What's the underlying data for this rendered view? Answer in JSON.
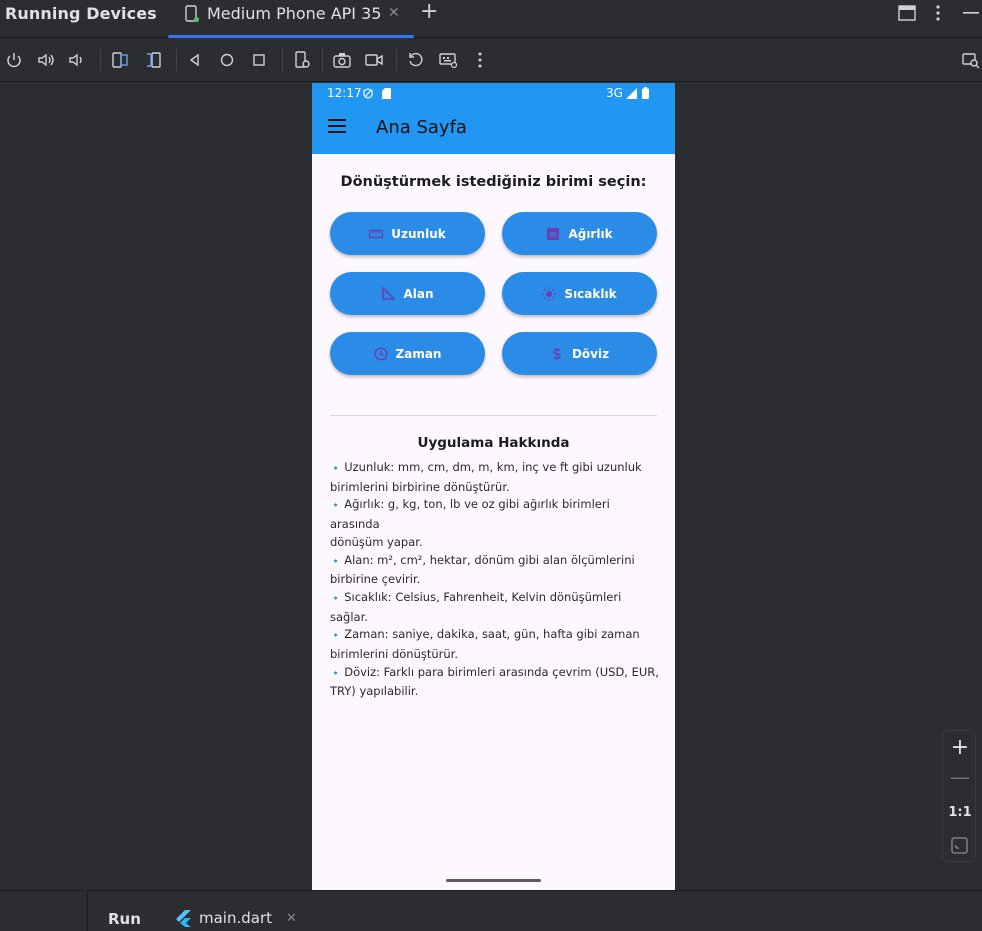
{
  "ide": {
    "panel_title": "Running Devices",
    "device_tab": "Medium Phone API 35",
    "bottom": {
      "run_label": "Run",
      "file_tab": "main.dart"
    },
    "zoom": {
      "one_to_one": "1:1"
    },
    "toolbar_icons": [
      "power-icon",
      "volume-up-icon",
      "volume-down-icon",
      "rotate-left-icon",
      "rotate-right-icon",
      "back-icon",
      "home-icon",
      "overview-icon",
      "device-settings-icon",
      "screenshot-icon",
      "screen-record-icon",
      "reset-icon",
      "keyboard-icon",
      "more-icon"
    ]
  },
  "phone": {
    "status": {
      "time": "12:17",
      "network": "3G"
    },
    "appbar": {
      "title": "Ana Sayfa"
    },
    "heading": "Dönüştürmek istediğiniz birimi seçin:",
    "buttons": [
      {
        "label": "Uzunluk",
        "icon": "ruler-icon"
      },
      {
        "label": "Ağırlık",
        "icon": "weight-icon"
      },
      {
        "label": "Alan",
        "icon": "area-icon"
      },
      {
        "label": "Sıcaklık",
        "icon": "sun-icon"
      },
      {
        "label": "Zaman",
        "icon": "clock-icon"
      },
      {
        "label": "Döviz",
        "icon": "dollar-icon"
      }
    ],
    "about": {
      "title": "Uygulama Hakkında",
      "lines": [
        "Uzunluk: mm, cm, dm, m, km, inç ve ft gibi uzunluk",
        "birimlerini birbirine dönüştürür.",
        "Ağırlık: g, kg, ton, lb ve oz gibi ağırlık birimleri arasında",
        "dönüşüm yapar.",
        "Alan: m², cm², hektar, dönüm gibi alan ölçümlerini",
        "birbirine çevirir.",
        "Sıcaklık: Celsius, Fahrenheit, Kelvin dönüşümleri",
        "sağlar.",
        "Zaman: saniye, dakika, saat, gün, hafta gibi zaman",
        "birimlerini dönüştürür.",
        "Döviz: Farklı para birimleri arasında çevrim (USD, EUR,",
        "TRY) yapılabilir."
      ],
      "bullet": "🔹"
    },
    "colors": {
      "appbar": "#2196f3",
      "button": "#2a8ce6",
      "icon": "#6a3fb5"
    }
  }
}
